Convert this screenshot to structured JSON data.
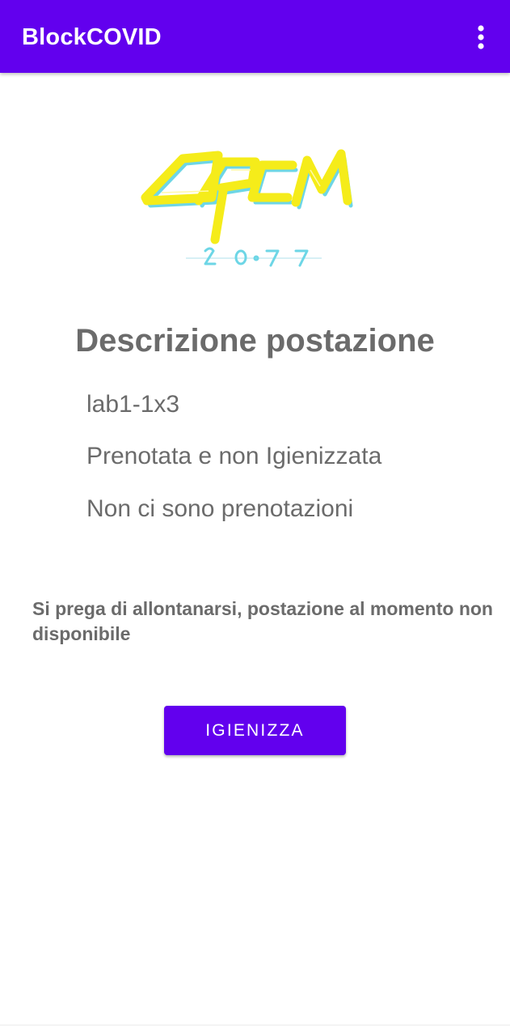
{
  "app_bar": {
    "title": "BlockCOVID",
    "menu_icon": "more-vert-icon",
    "background_color": "#6200ee"
  },
  "logo": {
    "icon": "opcm-2077-logo",
    "colors": [
      "#f5ec1a",
      "#6dd6e6"
    ]
  },
  "workstation": {
    "heading": "Descrizione postazione",
    "id": "lab1-1x3",
    "status": "Prenotata e non Igienizzata",
    "bookings": "Non ci sono prenotazioni"
  },
  "warning": {
    "message": "Si prega di allontanarsi, postazione al momento non disponibile"
  },
  "actions": {
    "sanitize_label": "IGIENIZZA",
    "accent_color": "#6200ee"
  }
}
